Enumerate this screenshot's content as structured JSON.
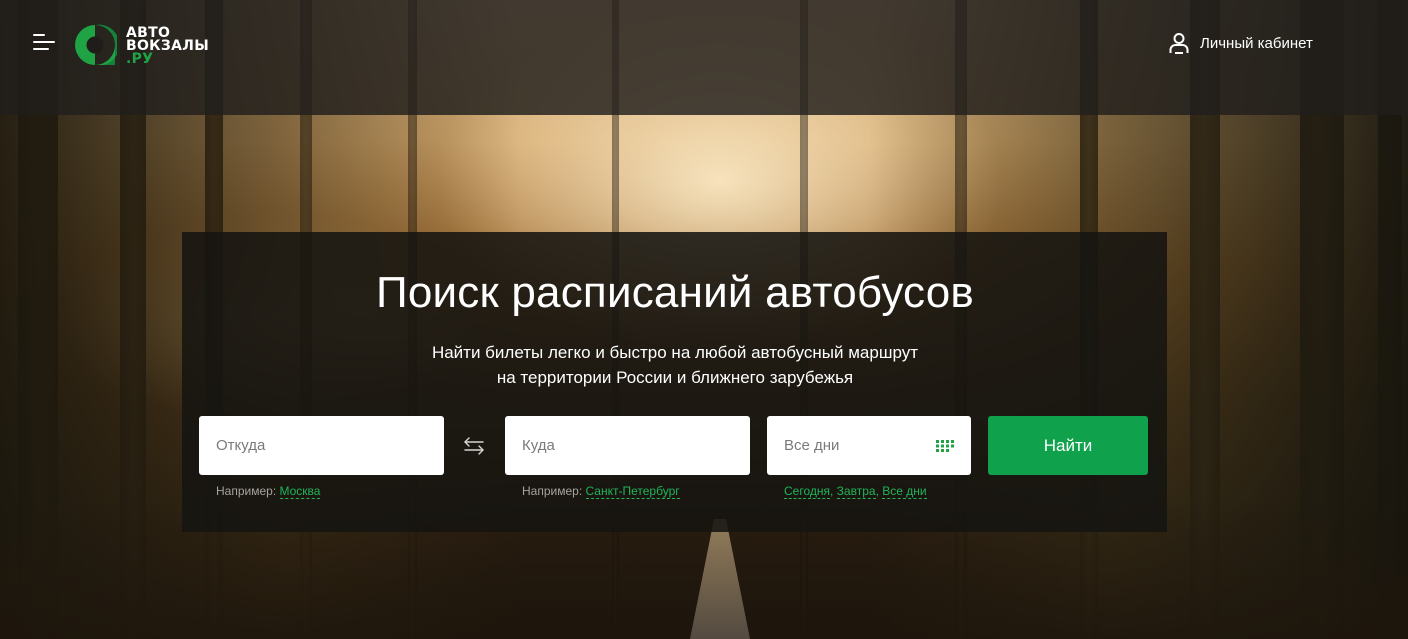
{
  "header": {
    "logo": {
      "line1": "АВТО",
      "line2": "ВОКЗАЛЫ",
      "line3": ".РУ",
      "brand_color": "#1fa345"
    },
    "menu_icon": "hamburger-menu-icon",
    "account": {
      "icon": "user-icon",
      "label": "Личный кабинет"
    }
  },
  "hero": {
    "title": "Поиск расписаний автобусов",
    "subtitle_line1": "Найти билеты легко и быстро на любой автобусный маршрут",
    "subtitle_line2": "на территории России и ближнего зарубежья"
  },
  "search": {
    "from": {
      "placeholder": "Откуда",
      "value": "",
      "hint_prefix": "Например:",
      "hint_link": "Москва"
    },
    "swap_icon": "swap-arrows-icon",
    "to": {
      "placeholder": "Куда",
      "value": "",
      "hint_prefix": "Например:",
      "hint_link": "Санкт-Петербург"
    },
    "date": {
      "value": "Все дни",
      "icon": "calendar-icon",
      "quick_links": [
        "Сегодня",
        "Завтра",
        "Все дни"
      ]
    },
    "submit_label": "Найти",
    "accent_color": "#0fa14b"
  }
}
